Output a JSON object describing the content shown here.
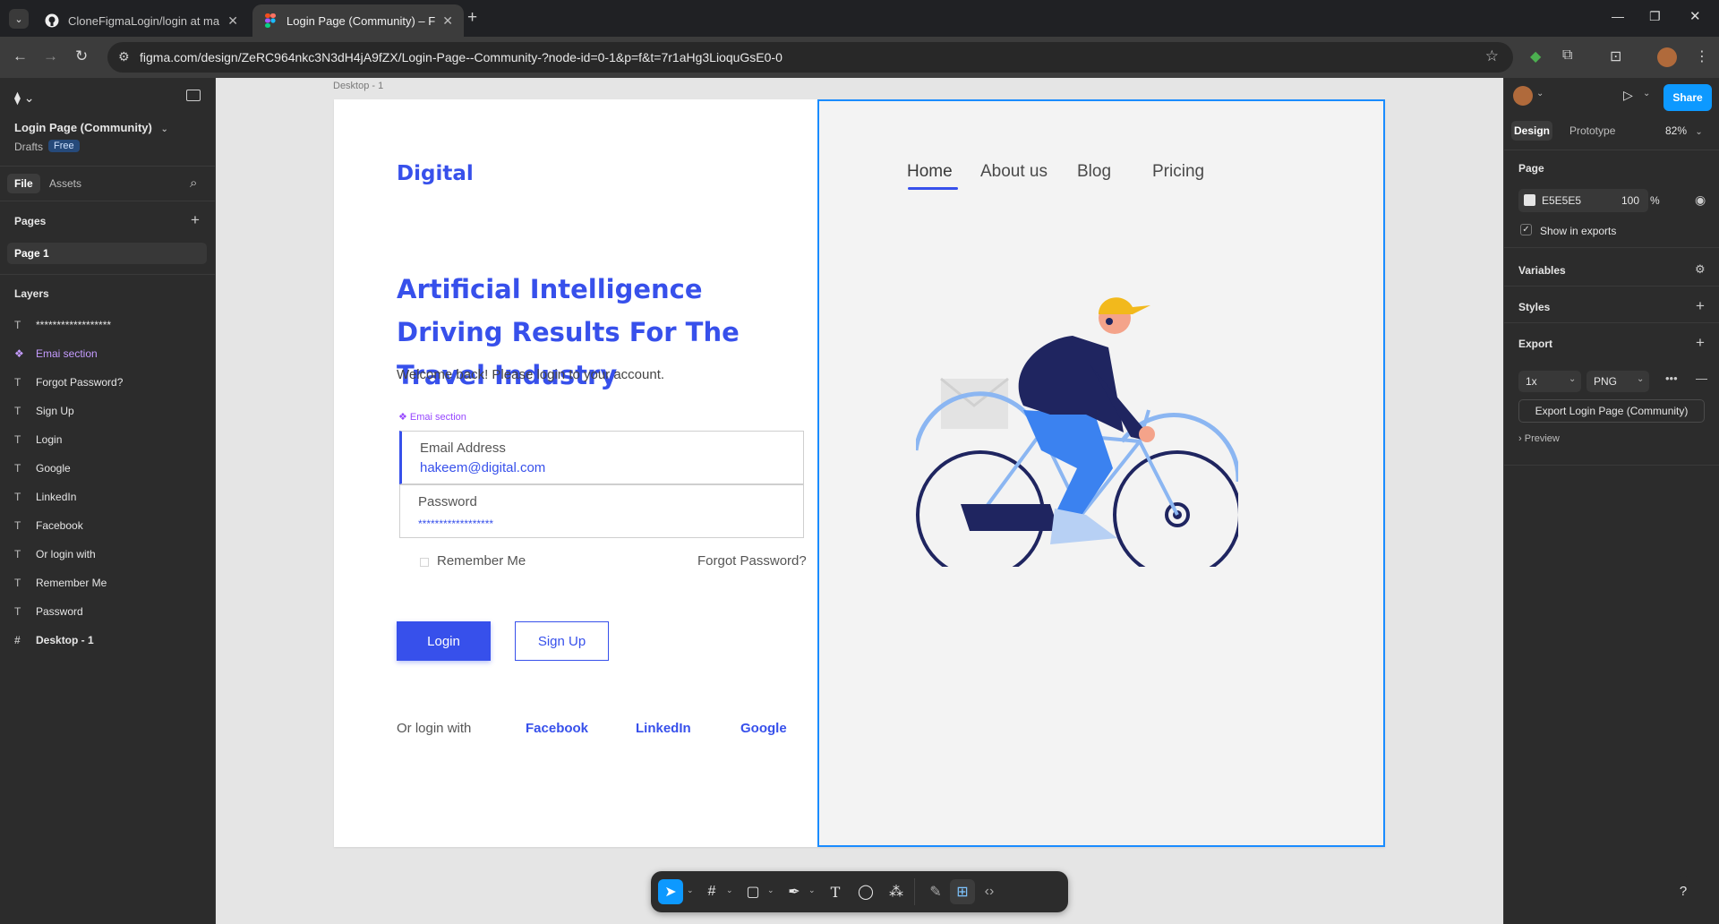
{
  "browser": {
    "tabs": [
      {
        "label": "CloneFigmaLogin/login at main",
        "icon": "github-icon"
      },
      {
        "label": "Login Page (Community) – Figma",
        "icon": "figma-icon"
      }
    ],
    "url": "figma.com/design/ZeRC964nkc3N3dH4jA9fZX/Login-Page--Community-?node-id=0-1&p=f&t=7r1aHg3LioquGsE0-0"
  },
  "left_panel": {
    "file_name": "Login Page (Community)",
    "drafts_label": "Drafts",
    "plan_badge": "Free",
    "tabs": {
      "file": "File",
      "assets": "Assets"
    },
    "pages_heading": "Pages",
    "current_page": "Page 1",
    "layers_heading": "Layers",
    "layers": [
      {
        "label": "******************",
        "type": "text"
      },
      {
        "label": "Emai section",
        "type": "component"
      },
      {
        "label": "Forgot Password?",
        "type": "text"
      },
      {
        "label": "Sign Up",
        "type": "text"
      },
      {
        "label": "Login",
        "type": "text"
      },
      {
        "label": "Google",
        "type": "text"
      },
      {
        "label": "LinkedIn",
        "type": "text"
      },
      {
        "label": "Facebook",
        "type": "text"
      },
      {
        "label": "Or login with",
        "type": "text"
      },
      {
        "label": "Remember Me",
        "type": "text"
      },
      {
        "label": "Password",
        "type": "text"
      },
      {
        "label": "Desktop - 1",
        "type": "frame"
      }
    ]
  },
  "canvas": {
    "frame_label": "Desktop - 1",
    "design": {
      "brand": "Digital",
      "headline": "Artificial Intelligence Driving Results For The Travel Industry",
      "welcome": "Welcome  back! Please login to your account.",
      "section_tag": "Emai section",
      "email_label": "Email Address",
      "email_value": "hakeem@digital.com",
      "password_label": "Password",
      "password_value": "******************",
      "remember": "Remember Me",
      "forgot": "Forgot Password?",
      "login_btn": "Login",
      "signup_btn": "Sign Up",
      "or_login": "Or login with",
      "social": [
        "Facebook",
        "LinkedIn",
        "Google"
      ],
      "nav": [
        "Home",
        "About us",
        "Blog",
        "Pricing"
      ],
      "accent_color": "#3750EB"
    }
  },
  "right_panel": {
    "share_label": "Share",
    "tabs": {
      "design": "Design",
      "prototype": "Prototype"
    },
    "zoom": "82%",
    "page_heading": "Page",
    "page_color": "E5E5E5",
    "page_opacity": "100",
    "percent_sign": "%",
    "show_in_exports": "Show in exports",
    "variables": "Variables",
    "styles": "Styles",
    "export": "Export",
    "export_scale": "1x",
    "export_format": "PNG",
    "export_button": "Export Login Page (Community)",
    "preview": "Preview"
  },
  "toolbar": {
    "tools": [
      "move-icon",
      "frame-icon",
      "rectangle-icon",
      "pen-icon",
      "text-icon",
      "comment-icon",
      "actions-icon",
      "draw-icon",
      "dev-mode-icon",
      "code-icon"
    ]
  },
  "help_label": "?"
}
